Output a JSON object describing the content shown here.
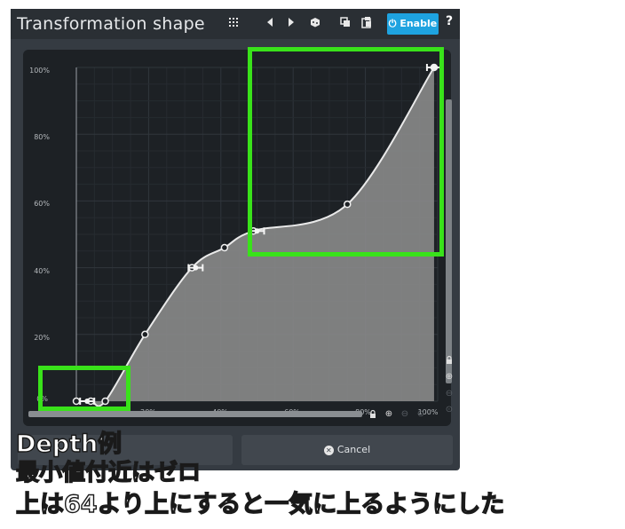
{
  "window": {
    "title": "Transformation shape",
    "enable_label": "Enable",
    "help_label": "?",
    "toolbar_icons": [
      "grid-icon",
      "prev-icon",
      "next-icon",
      "random-icon",
      "copy-icon",
      "paste-icon"
    ]
  },
  "graph": {
    "y_labels": [
      "100%",
      "80%",
      "60%",
      "40%",
      "20%",
      "0%"
    ],
    "x_labels": [
      "0%",
      "20%",
      "40%",
      "60%",
      "80%",
      "100%"
    ],
    "curve_points": [
      [
        0.0,
        0.0
      ],
      [
        0.04,
        0.0
      ],
      [
        0.08,
        0.0
      ],
      [
        0.19,
        0.2
      ],
      [
        0.32,
        0.4
      ],
      [
        0.41,
        0.46
      ],
      [
        0.49,
        0.51
      ],
      [
        0.75,
        0.59
      ],
      [
        0.99,
        1.0
      ]
    ],
    "handle_points": [
      [
        0.03,
        0.0
      ],
      [
        0.33,
        0.4
      ],
      [
        0.5,
        0.51
      ],
      [
        0.99,
        1.0
      ]
    ],
    "fill_color": "#8a8a8a",
    "curve_color": "#eaeaea"
  },
  "buttons": {
    "cancel_label": "Cancel"
  },
  "annotation": {
    "highlight_color": "#39e21a",
    "caption_lines": [
      "Depth例",
      "最小値付近はゼロ",
      "上は64より上にすると一気に上るようにした"
    ]
  }
}
